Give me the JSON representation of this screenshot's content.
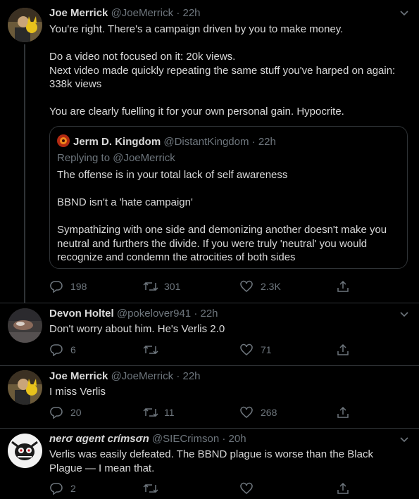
{
  "tweets": [
    {
      "name": "Joe Merrick",
      "handle": "@JoeMerrick",
      "time": "22h",
      "text": "You're right. There's a campaign driven by you to make money.\n\nDo a video not focused on it: 20k views.\nNext video made quickly repeating the same stuff you've harped on again: 338k views\n\nYou are clearly fuelling it for your own personal gain. Hypocrite.",
      "quote": {
        "name": "Jerm D. Kingdom",
        "handle": "@DistantKingdom",
        "time": "22h",
        "replying_to_label": "Replying to",
        "replying_to": "@JoeMerrick",
        "text": "The offense is in your total lack of self awareness\n\nBBND isn't a 'hate campaign'\n\nSympathizing with one side and demonizing another doesn't make you neutral and furthers the divide. If you were truly 'neutral' you would recognize and condemn the atrocities of both sides"
      },
      "replies": "198",
      "retweets": "301",
      "likes": "2.3K"
    },
    {
      "name": "Devon Holtel",
      "handle": "@pokelover941",
      "time": "22h",
      "text": "Don't worry about him. He's Verlis 2.0",
      "replies": "6",
      "retweets": "",
      "likes": "71"
    },
    {
      "name": "Joe Merrick",
      "handle": "@JoeMerrick",
      "time": "22h",
      "text": "I miss Verlis",
      "replies": "20",
      "retweets": "11",
      "likes": "268"
    },
    {
      "name": "nerσ αgent crímsσn",
      "handle": "@SIECrimson",
      "time": "20h",
      "text": "Verlis was easily defeated. The BBND plague is worse than the Black Plague — I mean that.",
      "replies": "2",
      "retweets": "",
      "likes": ""
    }
  ],
  "separator": "·",
  "colors": {
    "background": "#000000",
    "text": "#d9d9d9",
    "muted": "#6e767d",
    "border": "#2f3336"
  },
  "icons": [
    "reply-icon",
    "retweet-icon",
    "like-icon",
    "share-icon",
    "chevron-down-icon"
  ]
}
